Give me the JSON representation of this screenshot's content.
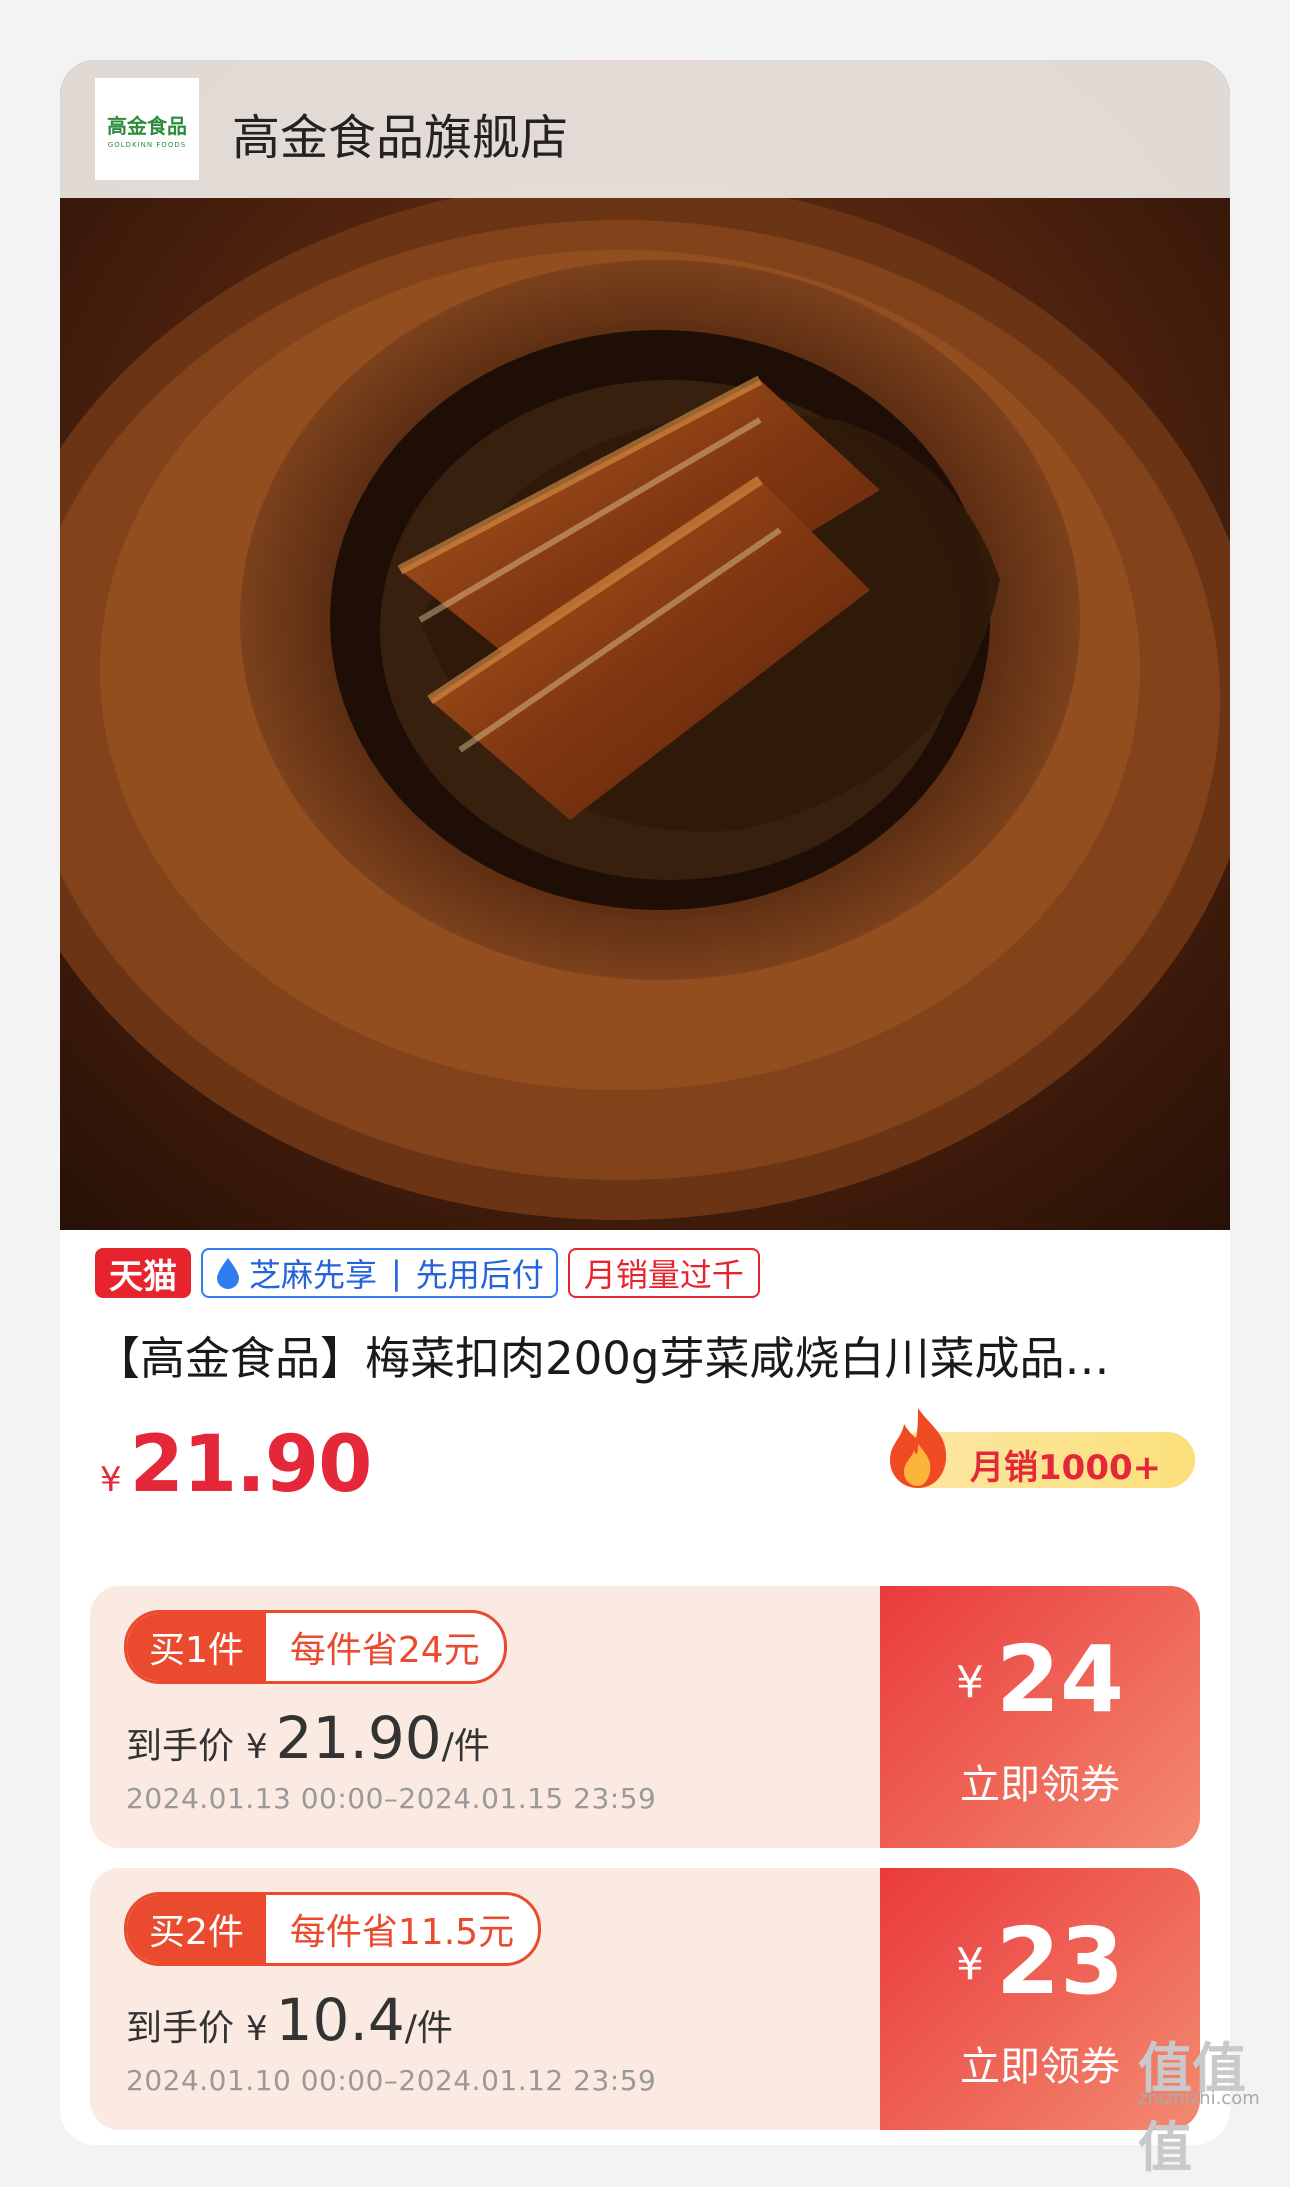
{
  "store": {
    "logo_text": "高金食品",
    "logo_sub": "GOLDKINN FOODS",
    "name": "高金食品旗舰店"
  },
  "tags": {
    "tmall": "天猫",
    "zhima_left": "芝麻先享",
    "zhima_right": "先用后付",
    "sales": "月销量过千"
  },
  "product": {
    "title": "【高金食品】梅菜扣肉200g芽菜咸烧白川菜成品…",
    "currency": "¥",
    "price": "21.90",
    "monthly_sales": "月销1000+"
  },
  "coupons": [
    {
      "buy": "买1件",
      "save": "每件省24元",
      "deal_label": "到手价",
      "currency": "¥",
      "deal_price": "21.90",
      "unit": "/件",
      "period": "2024.01.13 00:00–2024.01.15 23:59",
      "amount": "24",
      "claim": "立即领券"
    },
    {
      "buy": "买2件",
      "save": "每件省11.5元",
      "deal_label": "到手价",
      "currency": "¥",
      "deal_price": "10.4",
      "unit": "/件",
      "period": "2024.01.10 00:00–2024.01.12 23:59",
      "amount": "23",
      "claim": "立即领券"
    }
  ],
  "watermark": {
    "logo": "值值值",
    "site": "zhizhizhi.com"
  },
  "colors": {
    "price_red": "#e4283a",
    "tmall_red": "#e7232e",
    "zhima_blue": "#2563d9",
    "coupon_orange": "#ea4a2e"
  }
}
